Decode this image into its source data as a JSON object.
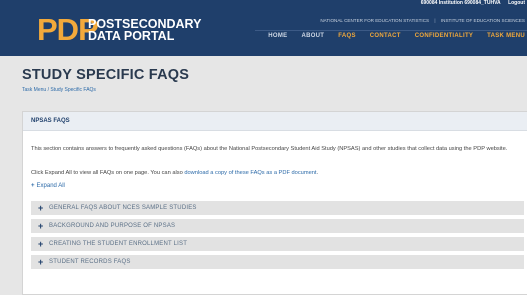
{
  "header": {
    "logo_mark": "PDP",
    "logo_line1": "POSTSECONDARY",
    "logo_line2": "DATA PORTAL",
    "institution": "690084 Institution 690084_TUHVA",
    "logout": "Logout",
    "link_nces": "NATIONAL CENTER FOR EDUCATION STATISTICS",
    "link_ies": "INSTITUTE OF EDUCATION SCIENCES",
    "nav": [
      "HOME",
      "ABOUT",
      "FAQS",
      "CONTACT",
      "CONFIDENTIALITY",
      "TASK MENU"
    ]
  },
  "page": {
    "title": "STUDY SPECIFIC FAQS",
    "breadcrumb": "Task Menu / Study Specific FAQs"
  },
  "panel": {
    "title": "NPSAS FAQS",
    "intro": "This section contains answers to frequently asked questions (FAQs) about the National Postsecondary Student Aid Study (NPSAS) and other studies that collect data using the PDP website.",
    "intro2_prefix": "Click Expand All to view all FAQs on one page. You can also ",
    "intro2_link": "download a copy of these FAQs as a PDF document",
    "intro2_suffix": ".",
    "expand_all": "Expand All",
    "sections": [
      "GENERAL FAQS ABOUT NCES SAMPLE STUDIES",
      "BACKGROUND AND PURPOSE OF NPSAS",
      "CREATING THE STUDENT ENROLLMENT LIST",
      "STUDENT RECORDS FAQS"
    ]
  },
  "colors": {
    "header_bg": "#1f3f6b",
    "logo_accent": "#f2a93b",
    "link": "#2c6aa8",
    "accordion_bg": "#e2e2e2"
  }
}
